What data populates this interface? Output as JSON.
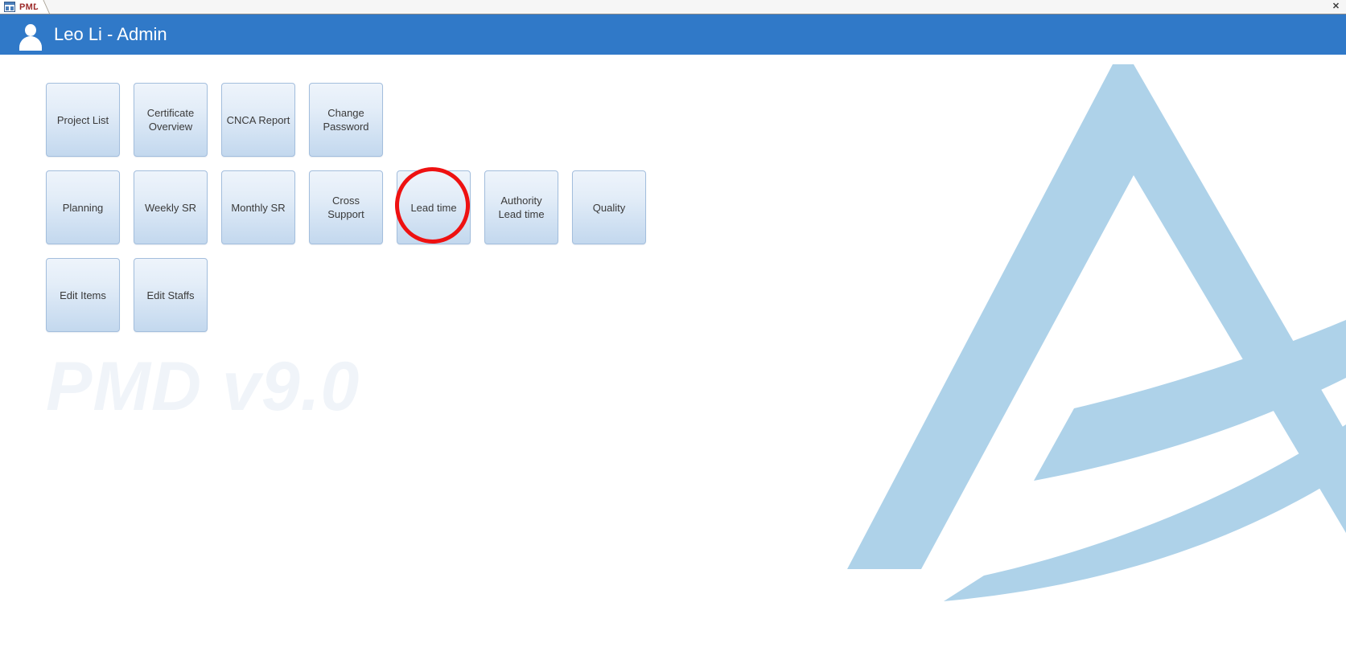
{
  "window": {
    "tab": {
      "label": "PMD",
      "icon": "access-form-icon",
      "close_label": "✕"
    }
  },
  "header": {
    "user_icon": "user-avatar-icon",
    "title": "Leo Li - Admin",
    "background_color": "#3079c8"
  },
  "watermark": {
    "text": "PMD v9.0",
    "color": "#f0f4f9"
  },
  "logo": {
    "name": "company-chevron-logo",
    "color": "#aed2e9"
  },
  "menu": {
    "rows": [
      {
        "buttons": [
          {
            "label": "Project List"
          },
          {
            "label": "Certificate\nOverview"
          },
          {
            "label": "CNCA Report"
          },
          {
            "label": "Change\nPassword"
          }
        ]
      },
      {
        "buttons": [
          {
            "label": "Planning"
          },
          {
            "label": "Weekly SR"
          },
          {
            "label": "Monthly SR"
          },
          {
            "label": "Cross Support"
          },
          {
            "label": "Lead time"
          },
          {
            "label": "Authority\nLead time"
          },
          {
            "label": "Quality"
          }
        ]
      },
      {
        "buttons": [
          {
            "label": "Edit Items"
          },
          {
            "label": "Edit Staffs"
          }
        ]
      }
    ]
  },
  "annotation": {
    "shape": "circle",
    "color": "#ee1111",
    "target": "Lead time"
  }
}
